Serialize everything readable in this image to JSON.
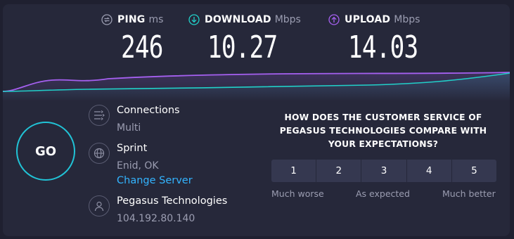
{
  "metrics": {
    "ping": {
      "label": "PING",
      "unit": "ms",
      "value": "246",
      "icon": "ping-icon",
      "color": "#9b9db1"
    },
    "download": {
      "label": "DOWNLOAD",
      "unit": "Mbps",
      "value": "10.27",
      "icon": "download-arrow-icon",
      "color": "#21d0c9"
    },
    "upload": {
      "label": "UPLOAD",
      "unit": "Mbps",
      "value": "14.03",
      "icon": "upload-arrow-icon",
      "color": "#a560f0"
    }
  },
  "go_button": {
    "label": "GO"
  },
  "connections": {
    "title": "Connections",
    "value": "Multi",
    "icon": "connections-icon"
  },
  "server": {
    "isp": "Sprint",
    "location": "Enid, OK",
    "change_link": "Change Server",
    "icon": "globe-icon"
  },
  "user": {
    "provider": "Pegasus Technologies",
    "ip": "104.192.80.140",
    "icon": "person-icon"
  },
  "survey": {
    "question": "HOW DOES THE CUSTOMER SERVICE OF PEGASUS TECHNOLOGIES COMPARE WITH YOUR EXPECTATIONS?",
    "options": [
      "1",
      "2",
      "3",
      "4",
      "5"
    ],
    "scale_low": "Much worse",
    "scale_mid": "As expected",
    "scale_high": "Much better"
  },
  "colors": {
    "background": "#1f2030",
    "panel": "#26283a",
    "accent_go": "#21c3d6",
    "link": "#33b4ff",
    "button": "#353850"
  }
}
